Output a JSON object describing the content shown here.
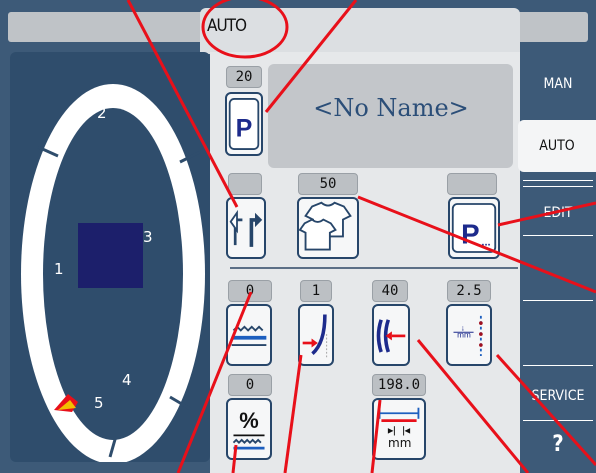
{
  "header": {
    "mode_title": "AUTO"
  },
  "program": {
    "number": "20",
    "name": "<No Name>"
  },
  "parameters": {
    "garment_value": "50",
    "p0_value": "0",
    "p1_value": "1",
    "p2_value": "40",
    "p3_value": "2.5",
    "p4_value": "0",
    "p5_value": "198.0",
    "p5_unit": "mm"
  },
  "stacker": {
    "zones": [
      "1",
      "2",
      "3",
      "4",
      "5"
    ]
  },
  "tabs": {
    "man": "MAN",
    "auto": "AUTO",
    "edit": "EDIT",
    "service": "SERVICE",
    "help": "?"
  },
  "colors": {
    "panel": "#2f4d6c",
    "accent_blue": "#27466a",
    "annotation_red": "#e8101a"
  }
}
